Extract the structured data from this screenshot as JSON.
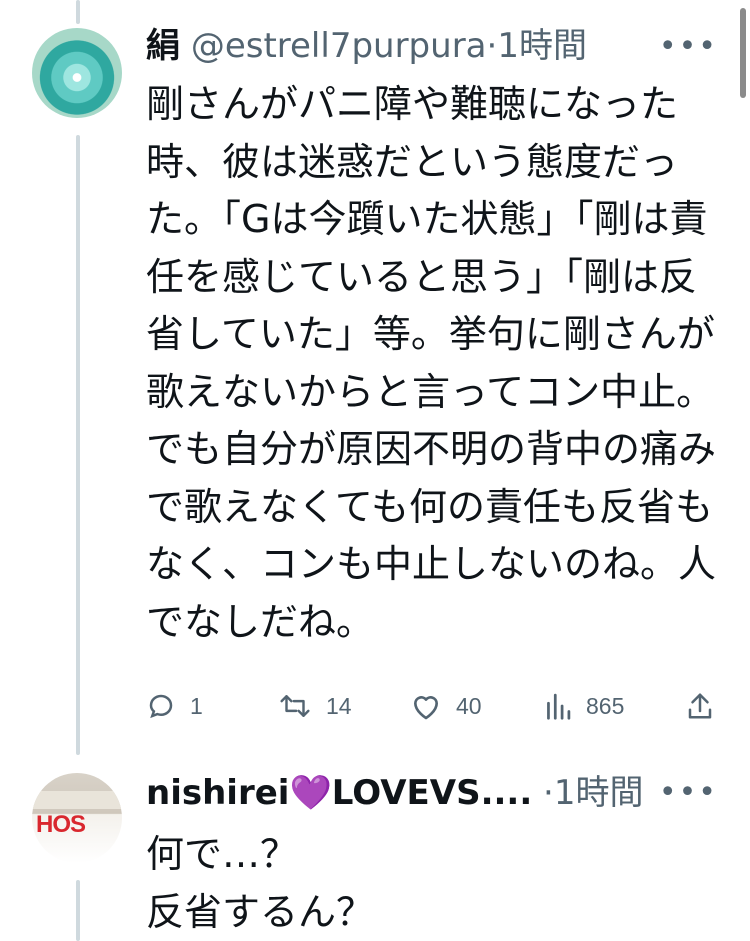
{
  "posts": [
    {
      "display_name": "絹",
      "handle": "@estrell7purpura",
      "separator": "·",
      "time": "1時間",
      "more_label": "•••",
      "text": "剛さんがパニ障や難聴になった時、彼は迷惑だという態度だった。「Gは今躓いた状態」「剛は責任を感じていると思う」「剛は反省していた」等。挙句に剛さんが歌えないからと言ってコン中止。でも自分が原因不明の背中の痛みで歌えなくても何の責任も反省もなく、コンも中止しないのね。人でなしだね。",
      "actions": {
        "reply_count": "1",
        "retweet_count": "14",
        "like_count": "40",
        "view_count": "865"
      }
    },
    {
      "display_name_prefix": "nishirei",
      "display_name_heart": "💜",
      "display_name_suffix": "LOVEVS....",
      "separator": "·",
      "time": "1時間",
      "more_label": "•••",
      "text": "何で…？\n反省するん？",
      "avatar_text": "HOS"
    }
  ],
  "colors": {
    "text": "#0f1419",
    "secondary": "#536471",
    "thread_line": "#cfd9de",
    "heart": "#9b4de6"
  }
}
